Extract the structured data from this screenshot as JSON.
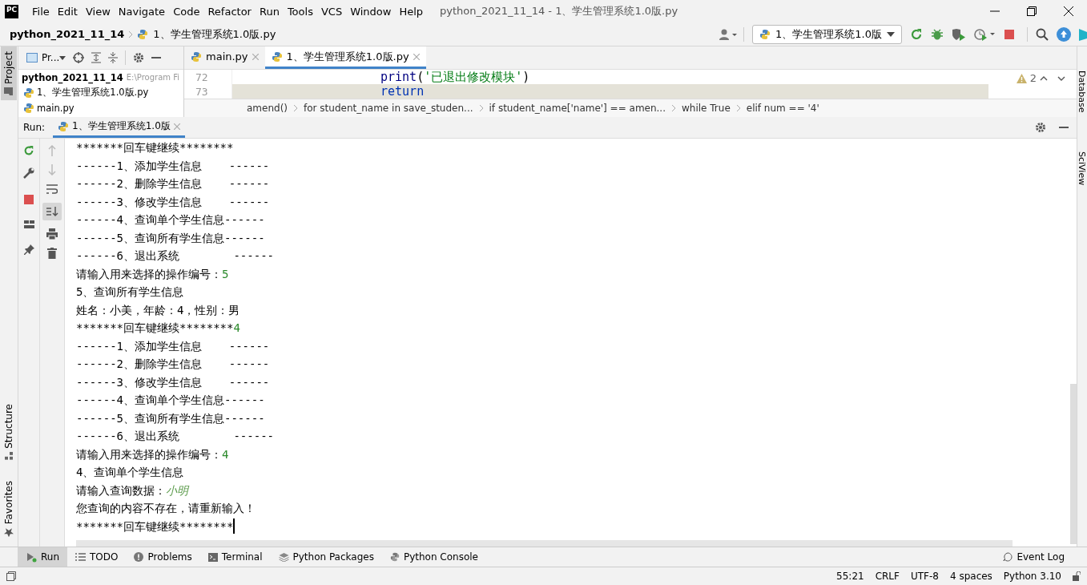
{
  "window": {
    "logo": "PC",
    "menu": [
      "File",
      "Edit",
      "View",
      "Navigate",
      "Code",
      "Refactor",
      "Run",
      "Tools",
      "VCS",
      "Window",
      "Help"
    ],
    "title": "python_2021_11_14 - 1、学生管理系统1.0版.py"
  },
  "navbar": {
    "project": "python_2021_11_14",
    "file": "1、学生管理系统1.0版.py",
    "run_config": "1、学生管理系统1.0版"
  },
  "left_stripe": [
    {
      "label": "Project",
      "selected": true
    },
    {
      "label": "Structure",
      "selected": false
    },
    {
      "label": "Favorites",
      "selected": false
    }
  ],
  "right_stripe": [
    "Database",
    "SciView"
  ],
  "project_panel": {
    "title": "Pr...",
    "root": {
      "name": "python_2021_11_14",
      "path": "E:\\Program Fi",
      "children": [
        {
          "name": "1、学生管理系统1.0版.py"
        },
        {
          "name": "main.py"
        }
      ]
    }
  },
  "editor": {
    "tabs": [
      {
        "label": "main.py",
        "selected": false
      },
      {
        "label": "1、学生管理系统1.0版.py",
        "selected": true
      }
    ],
    "lines": [
      {
        "number": "72",
        "current": false,
        "tokens": [
          {
            "text": "print",
            "kind": "builtin"
          },
          {
            "text": "(",
            "kind": "plain"
          },
          {
            "text": "'已退出修改模块'",
            "kind": "string"
          },
          {
            "text": ")",
            "kind": "plain"
          }
        ]
      },
      {
        "number": "73",
        "current": true,
        "tokens": [
          {
            "text": "return",
            "kind": "keyword"
          }
        ]
      }
    ],
    "warnings": "2",
    "breadcrumbs": [
      "amend()",
      "for student_name in save_studen...",
      "if student_name['name'] == amen...",
      "while True",
      "elif num == '4'"
    ]
  },
  "run_panel": {
    "label": "Run:",
    "tab": "1、学生管理系统1.0版",
    "console": [
      [
        {
          "text": "*******回车键继续********",
          "kind": "output"
        }
      ],
      [
        {
          "text": "------1、添加学生信息    ------",
          "kind": "output"
        }
      ],
      [
        {
          "text": "------2、删除学生信息    ------",
          "kind": "output"
        }
      ],
      [
        {
          "text": "------3、修改学生信息    ------",
          "kind": "output"
        }
      ],
      [
        {
          "text": "------4、查询单个学生信息------",
          "kind": "output"
        }
      ],
      [
        {
          "text": "------5、查询所有学生信息------",
          "kind": "output"
        }
      ],
      [
        {
          "text": "------6、退出系统        ------",
          "kind": "output"
        }
      ],
      [
        {
          "text": "请输入用来选择的操作编号：",
          "kind": "output"
        },
        {
          "text": "5",
          "kind": "input"
        }
      ],
      [
        {
          "text": "5、查询所有学生信息",
          "kind": "output"
        }
      ],
      [
        {
          "text": "姓名：小美，年龄：4，性别：男",
          "kind": "output"
        }
      ],
      [
        {
          "text": "*******回车键继续********",
          "kind": "output"
        },
        {
          "text": "4",
          "kind": "input"
        }
      ],
      [
        {
          "text": "------1、添加学生信息    ------",
          "kind": "output"
        }
      ],
      [
        {
          "text": "------2、删除学生信息    ------",
          "kind": "output"
        }
      ],
      [
        {
          "text": "------3、修改学生信息    ------",
          "kind": "output"
        }
      ],
      [
        {
          "text": "------4、查询单个学生信息------",
          "kind": "output"
        }
      ],
      [
        {
          "text": "------5、查询所有学生信息------",
          "kind": "output"
        }
      ],
      [
        {
          "text": "------6、退出系统        ------",
          "kind": "output"
        }
      ],
      [
        {
          "text": "请输入用来选择的操作编号：",
          "kind": "output"
        },
        {
          "text": "4",
          "kind": "input"
        }
      ],
      [
        {
          "text": "4、查询单个学生信息",
          "kind": "output"
        }
      ],
      [
        {
          "text": "请输入查询数据：",
          "kind": "output"
        },
        {
          "text": "小明",
          "kind": "input-text"
        }
      ],
      [
        {
          "text": "您查询的内容不存在，请重新输入！",
          "kind": "output"
        }
      ],
      [
        {
          "text": "*******回车键继续********",
          "kind": "output"
        }
      ]
    ]
  },
  "bottom_tabs": [
    {
      "label": "Run",
      "kind": "run",
      "selected": true
    },
    {
      "label": "TODO",
      "kind": "list",
      "selected": false
    },
    {
      "label": "Problems",
      "kind": "problems",
      "selected": false
    },
    {
      "label": "Terminal",
      "kind": "terminal",
      "selected": false
    },
    {
      "label": "Python Packages",
      "kind": "packages",
      "selected": false
    },
    {
      "label": "Python Console",
      "kind": "python",
      "selected": false
    }
  ],
  "event_log": "Event Log",
  "status_bar": [
    "55:21",
    "CRLF",
    "UTF-8",
    "4 spaces",
    "Python 3.10"
  ]
}
